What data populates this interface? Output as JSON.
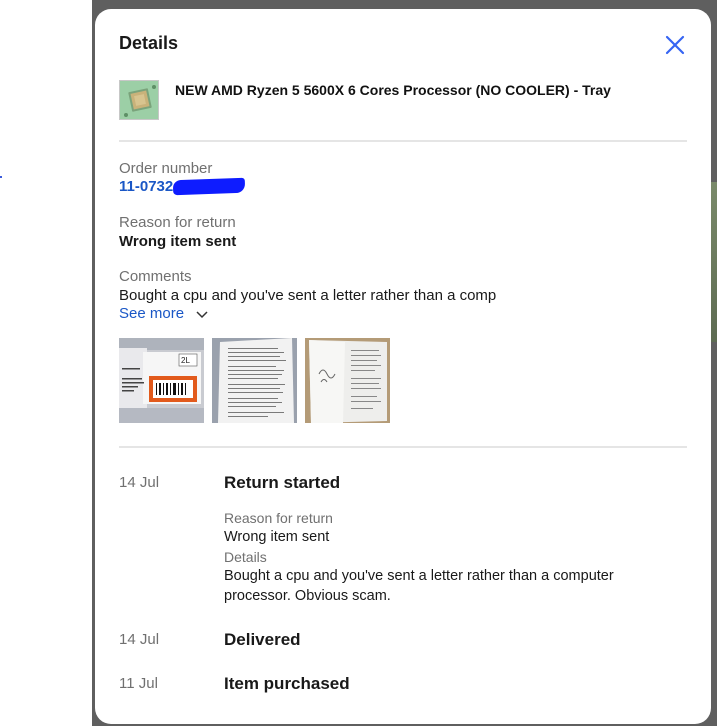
{
  "dialog": {
    "title": "Details",
    "item_title": "NEW AMD Ryzen 5 5600X 6 Cores Processor (NO COOLER) - Tray",
    "order_number_label": "Order number",
    "order_number_value": "11-07324",
    "reason_label": "Reason for return",
    "reason_value": "Wrong item sent",
    "comments_label": "Comments",
    "comments_value": "Bought a cpu and you've sent a letter rather than a comp",
    "see_more_label": "See more",
    "photos": [
      {
        "name": "parcel-label-photo"
      },
      {
        "name": "letter-photo-1"
      },
      {
        "name": "letter-photo-2"
      }
    ]
  },
  "timeline": [
    {
      "date": "14 Jul",
      "event": "Return started",
      "reason_label": "Reason for return",
      "reason_value": "Wrong item sent",
      "details_label": "Details",
      "details_value": "Bought a cpu and you've sent a letter rather than a computer processor. Obvious scam."
    },
    {
      "date": "14 Jul",
      "event": "Delivered"
    },
    {
      "date": "11 Jul",
      "event": "Item purchased"
    }
  ],
  "colors": {
    "link": "#1a57c6",
    "backdrop": "#5f5f5f",
    "redaction": "#0e1cff"
  }
}
